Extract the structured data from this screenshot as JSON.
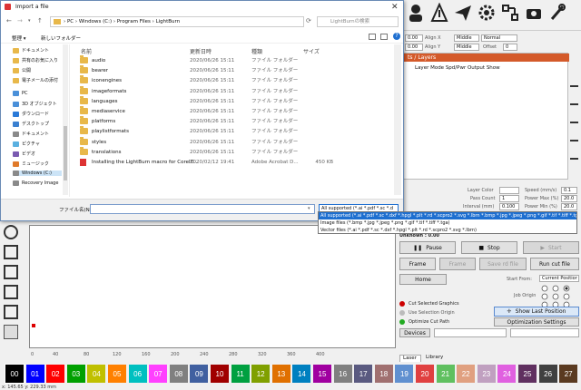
{
  "dialog": {
    "title": "Import a file",
    "breadcrumb": [
      "PC",
      "Windows (C:)",
      "Program Files",
      "LightBurn"
    ],
    "search_placeholder": "LightBurnの検索",
    "organize_label": "整理",
    "new_folder_label": "新しいフォルダー",
    "columns": {
      "name": "名前",
      "date": "更新日時",
      "type": "種類",
      "size": "サイズ"
    },
    "nav_items": [
      {
        "label": "ドキュメント",
        "color": "#e8b84a"
      },
      {
        "label": "共有のお気に入り",
        "color": "#e8b84a"
      },
      {
        "label": "公開",
        "color": "#e8b84a"
      },
      {
        "label": "電子メールの添付",
        "color": "#e8b84a"
      },
      {
        "label": "PC",
        "color": "#4a90d9"
      },
      {
        "label": "3D オブジェクト",
        "color": "#4a90d9"
      },
      {
        "label": "ダウンロード",
        "color": "#2a7ad8"
      },
      {
        "label": "デスクトップ",
        "color": "#3a80d0"
      },
      {
        "label": "ドキュメント",
        "color": "#8a8a8a"
      },
      {
        "label": "ピクチャ",
        "color": "#5ab0e0"
      },
      {
        "label": "ビデオ",
        "color": "#7a5ab0"
      },
      {
        "label": "ミュージック",
        "color": "#e07a2a"
      },
      {
        "label": "Windows (C:)",
        "color": "#8a8a8a"
      },
      {
        "label": "Recovery Image",
        "color": "#8a8a8a"
      }
    ],
    "files": [
      {
        "name": "audio",
        "date": "2020/06/26 15:11",
        "type": "ファイル フォルダー",
        "size": ""
      },
      {
        "name": "bearer",
        "date": "2020/06/26 15:11",
        "type": "ファイル フォルダー",
        "size": ""
      },
      {
        "name": "iconengines",
        "date": "2020/06/26 15:11",
        "type": "ファイル フォルダー",
        "size": ""
      },
      {
        "name": "imageformats",
        "date": "2020/06/26 15:11",
        "type": "ファイル フォルダー",
        "size": ""
      },
      {
        "name": "languages",
        "date": "2020/06/26 15:11",
        "type": "ファイル フォルダー",
        "size": ""
      },
      {
        "name": "mediaservice",
        "date": "2020/06/26 15:11",
        "type": "ファイル フォルダー",
        "size": ""
      },
      {
        "name": "platforms",
        "date": "2020/06/26 15:11",
        "type": "ファイル フォルダー",
        "size": ""
      },
      {
        "name": "playlistformats",
        "date": "2020/06/26 15:11",
        "type": "ファイル フォルダー",
        "size": ""
      },
      {
        "name": "styles",
        "date": "2020/06/26 15:11",
        "type": "ファイル フォルダー",
        "size": ""
      },
      {
        "name": "translations",
        "date": "2020/06/26 15:11",
        "type": "ファイル フォルダー",
        "size": ""
      },
      {
        "name": "Installing the LightBurn macro for CorelD...",
        "date": "2020/02/12 19:41",
        "type": "Adobe Acrobat D...",
        "size": "450 KB"
      }
    ],
    "filename_label": "ファイル名(N):",
    "filter_selected": "All supported (*.ai *.pdf *.sc *.d",
    "filter_options": [
      "All supported (*.ai *.pdf *.sc *.dxf *.hpgl *.plt *.rd *.scpro2 *.svg *.lbrn *.bmp *.jpg *.jpeg *.png *.gif *.tif *.tiff *.tga)",
      "Image files (*.bmp *.jpg *.jpeg *.png *.gif *.tif *.tiff *.tga)",
      "Vector files (*.ai *.pdf *.sc *.dxf *.hpgl *.plt *.rd *.scpro2 *.svg *.lbrn)"
    ]
  },
  "app": {
    "align_x_label": "Align X",
    "align_y_label": "Align Y",
    "align_x_value": "Middle",
    "align_y_value": "Middle",
    "normal_label": "Normal",
    "offset_label": "Offset",
    "offset_value": "0",
    "value_00": "0.00",
    "value_000": "0.000",
    "layers_title": "ts / Layers",
    "layers_cols": "Layer  Mode  Spd/Pwr  Output  Show",
    "props": [
      {
        "label": "Layer Color",
        "value": ""
      },
      {
        "label": "Pass Count",
        "value": "1"
      },
      {
        "label": "Interval (mm)",
        "value": "0.100"
      }
    ],
    "props_right": [
      {
        "label": "Speed (mm/s)",
        "value": "0.1"
      },
      {
        "label": "Power Max (%)",
        "value": "20.0"
      },
      {
        "label": "Power Min (%)",
        "value": "20.0"
      }
    ],
    "unknown_label": "Unknown : 0.00",
    "pause": "Pause",
    "stop": "Stop",
    "start": "Start",
    "frame1": "Frame",
    "frame2": "Frame",
    "save_gcode": "Save rd file",
    "run_gcode": "Run cut file",
    "home": "Home",
    "start_from_label": "Start From:",
    "start_from_value": "Current Positior",
    "job_origin_label": "Job Origin",
    "cut_selected": "Cut Selected Graphics",
    "use_selection_origin": "Use Selection Origin",
    "optimize_cut": "Optimize Cut Path",
    "show_last_position": "Show Last Position",
    "optimization_settings": "Optimization Settings",
    "devices": "Devices",
    "tab_laser": "Laser",
    "tab_library": "Library",
    "ruler": [
      "0",
      "40",
      "80",
      "120",
      "160",
      "200",
      "240",
      "280",
      "320",
      "360",
      "400"
    ],
    "coords": "x: 145.65 y: 229.33 mm",
    "palette": [
      {
        "label": "00",
        "color": "#000000"
      },
      {
        "label": "01",
        "color": "#0000ff"
      },
      {
        "label": "02",
        "color": "#ff0000"
      },
      {
        "label": "03",
        "color": "#00a000"
      },
      {
        "label": "04",
        "color": "#c0c000"
      },
      {
        "label": "05",
        "color": "#ff8000"
      },
      {
        "label": "06",
        "color": "#00c0c0"
      },
      {
        "label": "07",
        "color": "#ff40ff"
      },
      {
        "label": "08",
        "color": "#808080"
      },
      {
        "label": "09",
        "color": "#4060a0"
      },
      {
        "label": "10",
        "color": "#a00000"
      },
      {
        "label": "11",
        "color": "#00a040"
      },
      {
        "label": "12",
        "color": "#80a000"
      },
      {
        "label": "13",
        "color": "#e07000"
      },
      {
        "label": "14",
        "color": "#0080c0"
      },
      {
        "label": "15",
        "color": "#a000a0"
      },
      {
        "label": "16",
        "color": "#808080"
      },
      {
        "label": "17",
        "color": "#5a5a80"
      },
      {
        "label": "18",
        "color": "#a07070"
      },
      {
        "label": "19",
        "color": "#6090d0"
      },
      {
        "label": "20",
        "color": "#e04040"
      },
      {
        "label": "21",
        "color": "#60c060"
      },
      {
        "label": "22",
        "color": "#e0a080"
      },
      {
        "label": "23",
        "color": "#c0a0c0"
      },
      {
        "label": "24",
        "color": "#e060e0"
      },
      {
        "label": "25",
        "color": "#603060"
      },
      {
        "label": "26",
        "color": "#404040"
      },
      {
        "label": "27",
        "color": "#5a3a20"
      }
    ]
  }
}
